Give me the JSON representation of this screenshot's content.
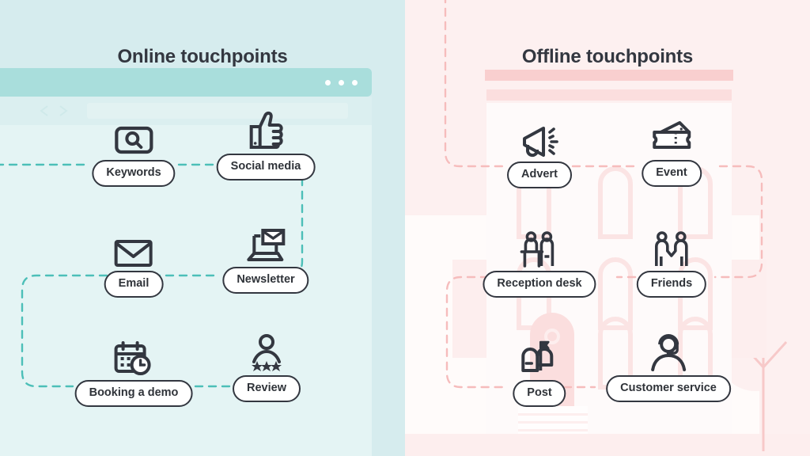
{
  "colors": {
    "online_bg": "#d6ecee",
    "online_browser_chrome": "#a9dedc",
    "online_browser_body": "#e4f4f4",
    "online_path": "#4cbfb8",
    "offline_bg": "#fdf0f0",
    "offline_building_roof": "#f9cfcf",
    "offline_building_face": "#fefafa",
    "offline_path": "#f6bcbc",
    "ink": "#333740",
    "pill_bg": "#ffffff"
  },
  "online": {
    "title": "Online touchpoints",
    "nodes": [
      {
        "label": "Keywords",
        "icon": "search-box-icon"
      },
      {
        "label": "Social media",
        "icon": "thumbs-up-icon"
      },
      {
        "label": "Email",
        "icon": "envelope-icon"
      },
      {
        "label": "Newsletter",
        "icon": "laptop-mail-icon"
      },
      {
        "label": "Booking a demo",
        "icon": "calendar-clock-icon"
      },
      {
        "label": "Review",
        "icon": "person-stars-icon"
      }
    ],
    "browser": {
      "window_dots": 3,
      "back_icon": "chevron-left-icon",
      "forward_icon": "chevron-right-icon",
      "url_bar": ""
    }
  },
  "offline": {
    "title": "Offline touchpoints",
    "nodes": [
      {
        "label": "Advert",
        "icon": "megaphone-icon"
      },
      {
        "label": "Event",
        "icon": "tickets-icon"
      },
      {
        "label": "Reception desk",
        "icon": "reception-desk-icon"
      },
      {
        "label": "Friends",
        "icon": "handshake-icon"
      },
      {
        "label": "Post",
        "icon": "mailbox-icon"
      },
      {
        "label": "Customer service",
        "icon": "headset-person-icon"
      }
    ],
    "building": {
      "door_icon": "arched-door",
      "window_icon": "arched-window",
      "tree_icon": "tree"
    }
  }
}
